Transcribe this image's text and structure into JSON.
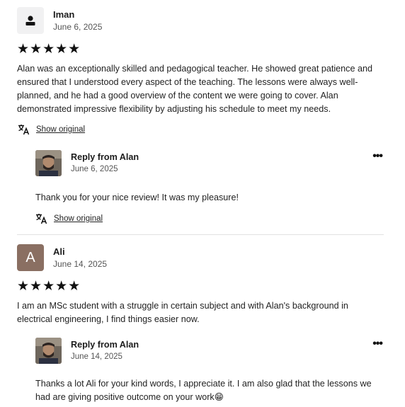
{
  "reviews": [
    {
      "name": "Iman",
      "date": "June 6, 2025",
      "avatar": {
        "type": "person-icon"
      },
      "stars": "★★★★★",
      "rating": 5,
      "text": "Alan was an exceptionally skilled and pedagogical teacher. He showed great patience and ensured that I understood every aspect of the teaching. The lessons were always well-planned, and he had a good overview of the content we were going to cover. Alan demonstrated impressive flexibility by adjusting his schedule to meet my needs.",
      "show_original": "Show original",
      "reply": {
        "title": "Reply from Alan",
        "date": "June 6, 2025",
        "more": "•••",
        "text": "Thank you for your nice review! It was my pleasure!",
        "show_original": "Show original"
      }
    },
    {
      "name": "Ali",
      "date": "June 14, 2025",
      "avatar": {
        "type": "letter",
        "letter": "A",
        "color": "#8a6f62"
      },
      "stars": "★★★★★",
      "rating": 5,
      "text": "I am an MSc student with a struggle in certain subject and with Alan's background in electrical engineering, I find things easier now.",
      "reply": {
        "title": "Reply from Alan",
        "date": "June 14, 2025",
        "more": "•••",
        "text": "Thanks a lot Ali for your kind words, I appreciate it. I am also glad that the lessons we had are giving positive outcome on your work😁"
      }
    }
  ]
}
